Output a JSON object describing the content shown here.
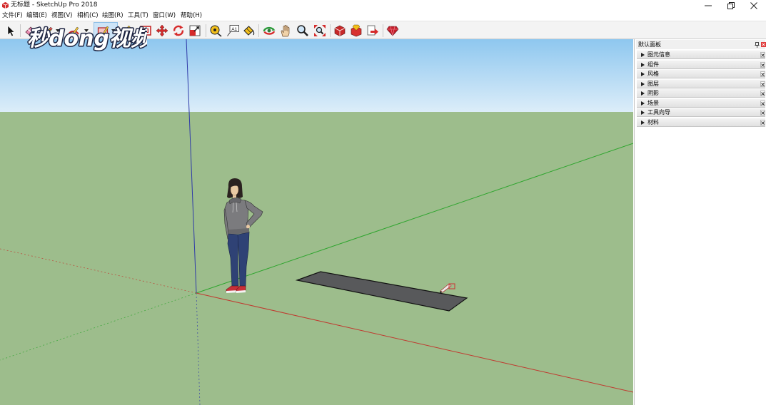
{
  "window": {
    "title": "无标题 - SketchUp Pro 2018",
    "app_icon": "sketchup-logo-icon",
    "controls": [
      "minimize-icon",
      "restore-icon",
      "close-icon"
    ]
  },
  "menu": {
    "items": [
      "文件(F)",
      "编辑(E)",
      "视图(V)",
      "相机(C)",
      "绘图(R)",
      "工具(T)",
      "窗口(W)",
      "帮助(H)"
    ]
  },
  "toolbar": {
    "tools": [
      "select-icon",
      "eraser-icon",
      "line-icon",
      "arc-icon",
      "rectangle-icon",
      "push-pull-icon",
      "offset-icon",
      "move-icon",
      "rotate-icon",
      "scale-icon",
      "tape-measure-icon",
      "text-icon",
      "paint-bucket-icon",
      "orbit-icon",
      "pan-icon",
      "zoom-icon",
      "zoom-extents-icon",
      "3d-warehouse-icon",
      "extension-warehouse-icon",
      "send-to-layout-icon",
      "extension-manager-icon"
    ],
    "active_tool": "rectangle-icon",
    "text_tool_glyph": "A1"
  },
  "watermark": "秒dong视频",
  "viewport": {
    "cursor": "rectangle-tool-cursor-icon"
  },
  "panel": {
    "title": "默认面板",
    "header_icons": [
      "pin-icon",
      "close-icon"
    ],
    "trays": [
      {
        "label": "图元信息",
        "state": "collapsed"
      },
      {
        "label": "组件",
        "state": "collapsed"
      },
      {
        "label": "风格",
        "state": "collapsed"
      },
      {
        "label": "图层",
        "state": "collapsed"
      },
      {
        "label": "阴影",
        "state": "collapsed"
      },
      {
        "label": "场景",
        "state": "collapsed"
      },
      {
        "label": "工具向导",
        "state": "collapsed"
      },
      {
        "label": "材料",
        "state": "collapsed"
      }
    ]
  },
  "colors": {
    "sky_top": "#8ec7ef",
    "sky_horizon": "#dcedf9",
    "ground": "#9dbd8c",
    "red_axis": "#c0392f",
    "green_axis": "#2ea52e",
    "blue_axis": "#2f3aa8",
    "face": "#58595b",
    "active_tool": "#cde4f7",
    "panel_close": "#e03c3c"
  }
}
